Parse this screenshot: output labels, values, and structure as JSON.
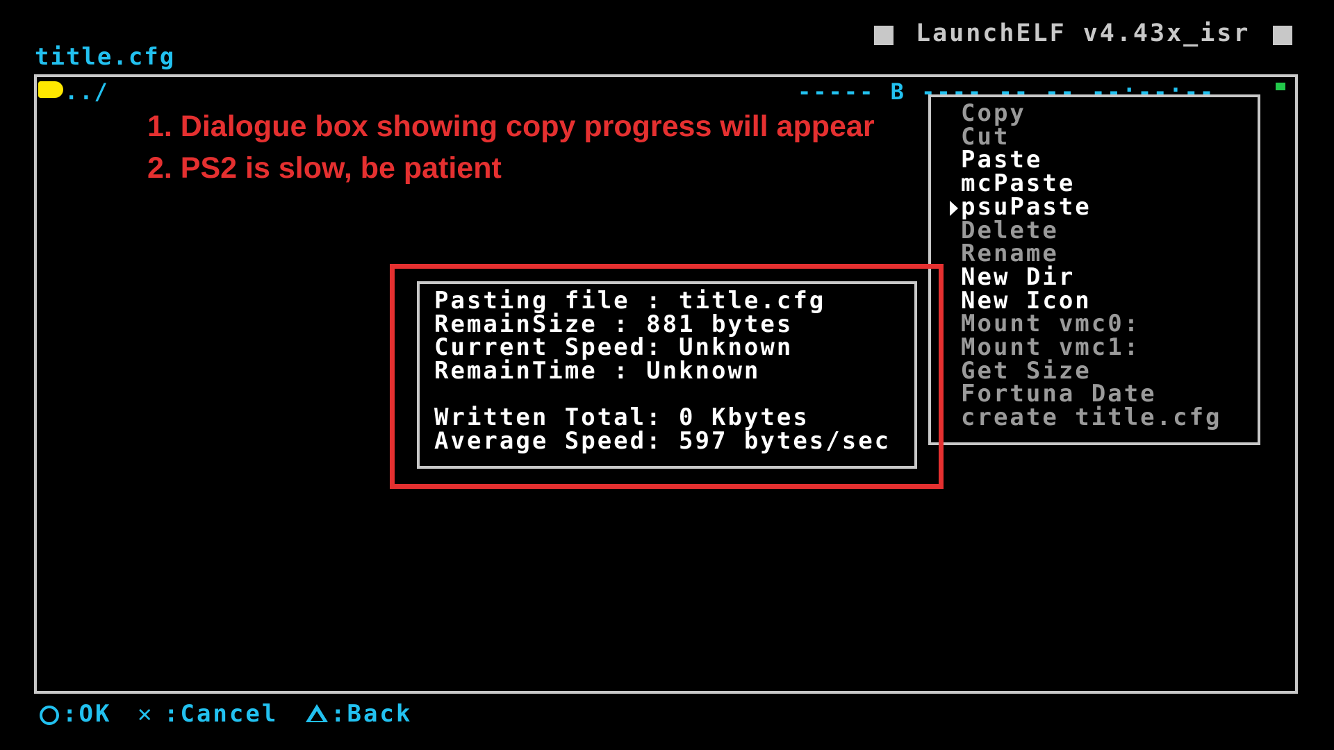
{
  "header": {
    "app_title": "LaunchELF v4.43x_isr",
    "path_title": "title.cfg"
  },
  "browser": {
    "parent_dir": "../",
    "drive_info_line": "----- B ---- -- -- --:--:--",
    "status_led_color": "#22c84a"
  },
  "annotations": {
    "line1": "1. Dialogue box showing copy progress will appear",
    "line2": "2. PS2 is slow, be patient",
    "color": "#e53030"
  },
  "context_menu": {
    "selected_index": 4,
    "items": [
      {
        "label": "Copy",
        "enabled": false
      },
      {
        "label": "Cut",
        "enabled": false
      },
      {
        "label": "Paste",
        "enabled": true
      },
      {
        "label": "mcPaste",
        "enabled": true
      },
      {
        "label": "psuPaste",
        "enabled": true
      },
      {
        "label": "Delete",
        "enabled": false
      },
      {
        "label": "Rename",
        "enabled": false
      },
      {
        "label": "New Dir",
        "enabled": true
      },
      {
        "label": "New Icon",
        "enabled": true
      },
      {
        "label": "Mount vmc0:",
        "enabled": false
      },
      {
        "label": "Mount vmc1:",
        "enabled": false
      },
      {
        "label": "Get Size",
        "enabled": false
      },
      {
        "label": "Fortuna Date",
        "enabled": false
      },
      {
        "label": "create title.cfg",
        "enabled": false
      }
    ]
  },
  "progress_dialog": {
    "lines": [
      "Pasting file : title.cfg",
      "RemainSize : 881 bytes",
      "Current Speed: Unknown",
      "RemainTime : Unknown",
      "",
      "Written Total: 0 Kbytes",
      "Average Speed: 597 bytes/sec"
    ]
  },
  "footer": {
    "ok_label": ":OK",
    "cancel_label": ":Cancel",
    "back_label": ":Back",
    "cross_glyph": "✕"
  },
  "colors": {
    "accent_cyan": "#22c1f0",
    "frame_gray": "#c8c8c8",
    "folder_yellow": "#ffe800",
    "disabled_gray": "#9a9a9a"
  }
}
